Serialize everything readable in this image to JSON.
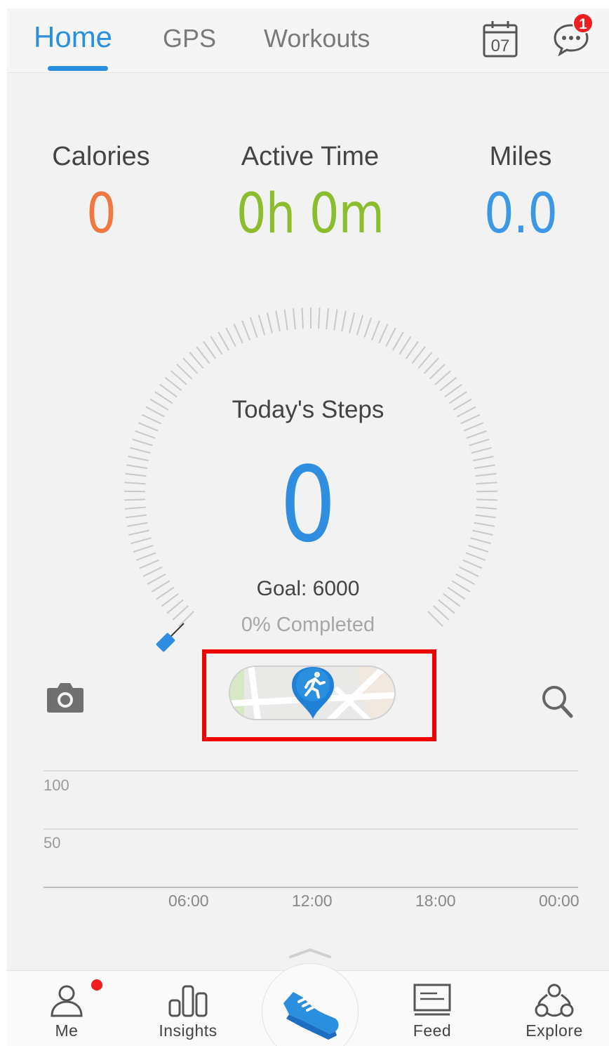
{
  "top_tabs": [
    {
      "label": "Home",
      "active": true
    },
    {
      "label": "GPS",
      "active": false
    },
    {
      "label": "Workouts",
      "active": false
    }
  ],
  "calendar": {
    "day": "07",
    "icon": "calendar-icon"
  },
  "messages": {
    "icon": "chat-bubble-icon",
    "badge": "1"
  },
  "stats": {
    "calories": {
      "label": "Calories",
      "value": "0",
      "color": "#f07840"
    },
    "active_time": {
      "label": "Active Time",
      "value": "0h 0m",
      "color": "#8cbd2e"
    },
    "miles": {
      "label": "Miles",
      "value": "0.0",
      "color": "#3c98e6"
    }
  },
  "steps": {
    "title": "Today's Steps",
    "value": "0",
    "goal": "Goal: 6000",
    "completed": "0% Completed",
    "progress": 0
  },
  "actions": {
    "camera_icon": "camera-icon",
    "gps_button_icon": "running-map-pin-icon",
    "search_icon": "search-icon"
  },
  "chart_data": {
    "type": "bar",
    "y_ticks": [
      "100",
      "50"
    ],
    "x_ticks": [
      "06:00",
      "12:00",
      "18:00",
      "00:00"
    ],
    "values": [],
    "ylim": [
      0,
      100
    ],
    "grid": true
  },
  "bottom_nav": {
    "me": {
      "label": "Me",
      "icon": "person-icon",
      "has_dot": true
    },
    "insights": {
      "label": "Insights",
      "icon": "bar-chart-icon"
    },
    "center": {
      "icon": "shoe-icon"
    },
    "feed": {
      "label": "Feed",
      "icon": "news-feed-icon"
    },
    "explore": {
      "label": "Explore",
      "icon": "community-icon"
    }
  },
  "colors": {
    "accent": "#2b8fe0",
    "highlight": "#f40000"
  }
}
